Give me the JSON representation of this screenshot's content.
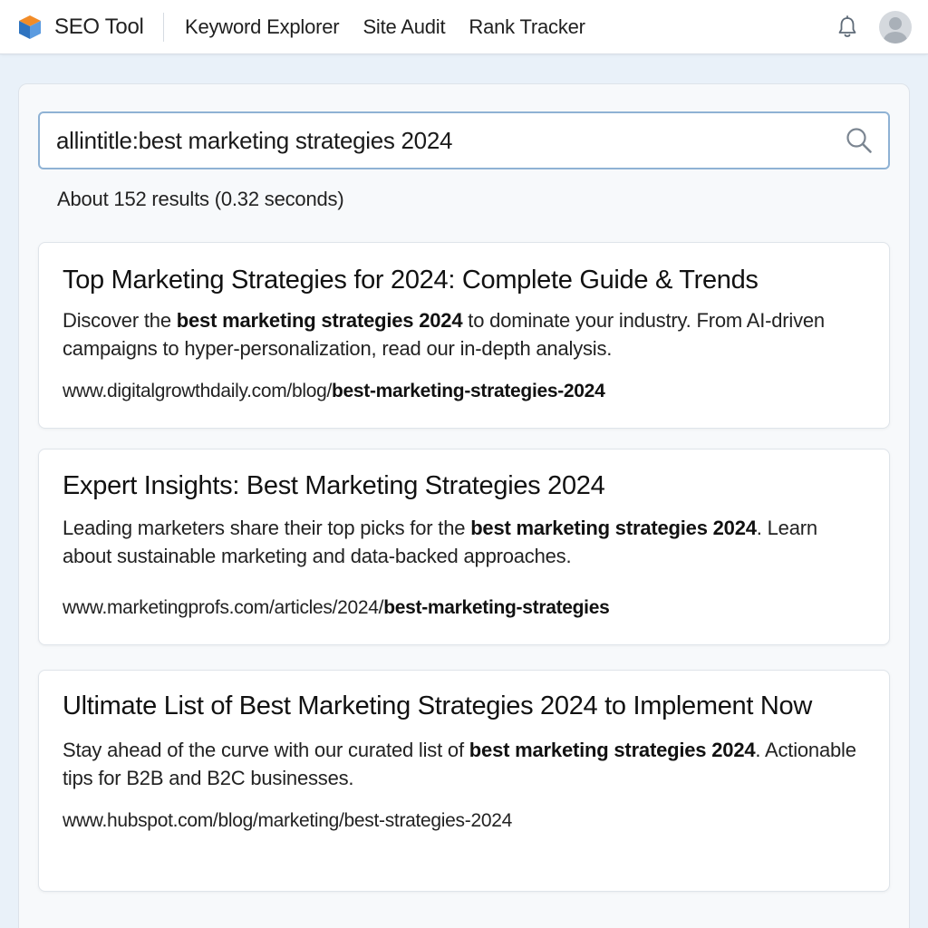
{
  "header": {
    "brand": "SEO Tool",
    "nav": [
      "Keyword Explorer",
      "Site Audit",
      "Rank Tracker"
    ]
  },
  "icons": {
    "logo": "cube-logo-icon",
    "notifications": "bell-icon",
    "user": "avatar-icon",
    "search": "search-icon"
  },
  "colors": {
    "accent": "#8fb2d4",
    "page_bg": "#e9f1f9",
    "logo_orange": "#f28c28",
    "logo_blue": "#2f74c0"
  },
  "search": {
    "query": "allintitle:best marketing strategies 2024",
    "results_summary": "About 152 results (0.32 seconds)"
  },
  "results": [
    {
      "title": "Top Marketing Strategies for 2024: Complete Guide & Trends",
      "desc_pre": "Discover the ",
      "desc_bold": "best marketing strategies 2024",
      "desc_post": " to dominate your industry. From AI-driven campaigns to hyper-personalization, read our in-depth analysis.",
      "url_pre": "www.digitalgrowthdaily.com/blog/",
      "url_bold": "best-marketing-strategies-2024"
    },
    {
      "title": "Expert Insights: Best Marketing Strategies 2024",
      "desc_pre": "Leading marketers share their top picks for the ",
      "desc_bold": "best marketing strategies 2024",
      "desc_post": ". Learn about sustainable marketing and data-backed approaches.",
      "url_pre": "www.marketingprofs.com/articles/2024/",
      "url_bold": "best-marketing-strategies"
    },
    {
      "title": "Ultimate List of Best Marketing Strategies 2024 to Implement Now",
      "desc_pre": "Stay ahead of the curve with our curated list of ",
      "desc_bold": "best marketing strategies 2024",
      "desc_post": ". Actionable tips for B2B and B2C businesses.",
      "url_pre": "www.hubspot.com/blog/marketing/best-strategies-2024",
      "url_bold": ""
    }
  ]
}
